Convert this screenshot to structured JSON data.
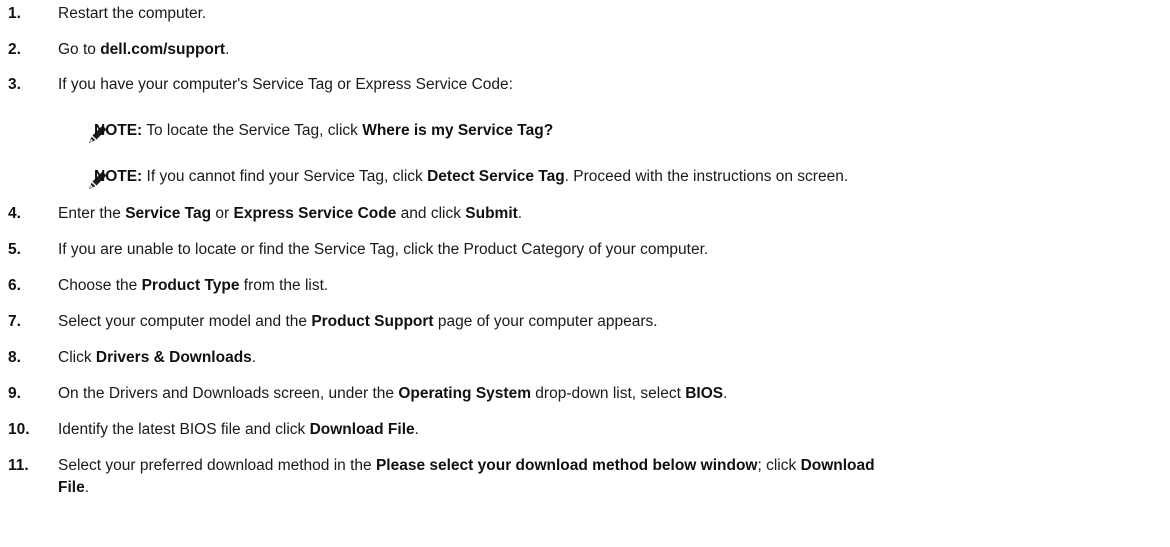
{
  "note_label": "NOTE:",
  "steps": [
    {
      "num": "1.",
      "parts": [
        "Restart the computer."
      ]
    },
    {
      "num": "2.",
      "parts": [
        "Go to ",
        "dell.com/support",
        "."
      ]
    },
    {
      "num": "3.",
      "parts": [
        "If you have your computer's Service Tag or Express Service Code:"
      ]
    },
    {
      "num": "4.",
      "parts": [
        "Enter the ",
        "Service Tag",
        " or ",
        "Express Service Code",
        " and click ",
        "Submit",
        "."
      ]
    },
    {
      "num": "5.",
      "parts": [
        "If you are unable to locate or find the Service Tag, click the Product Category of your computer."
      ]
    },
    {
      "num": "6.",
      "parts": [
        "Choose the ",
        "Product Type",
        " from the list."
      ]
    },
    {
      "num": "7.",
      "parts": [
        "Select your computer model and the ",
        "Product Support",
        " page of your computer appears."
      ]
    },
    {
      "num": "8.",
      "parts": [
        "Click ",
        "Drivers & Downloads",
        "."
      ]
    },
    {
      "num": "9.",
      "parts": [
        "On the Drivers and Downloads screen, under the ",
        "Operating System",
        " drop-down list, select ",
        "BIOS",
        "."
      ]
    },
    {
      "num": "10.",
      "parts": [
        "Identify the latest BIOS file and click ",
        "Download File",
        "."
      ]
    },
    {
      "num": "11.",
      "parts": [
        "Select your preferred download method in the ",
        "Please select your download method below window",
        "; click ",
        "Download",
        " ",
        "File",
        "."
      ]
    }
  ],
  "notes": [
    {
      "parts": [
        " To locate the Service Tag, click ",
        "Where is my Service Tag?"
      ]
    },
    {
      "parts": [
        " If you cannot find your Service Tag, click ",
        "Detect Service Tag",
        ". Proceed with the instructions on screen."
      ]
    }
  ],
  "icons": {
    "note": "pencil-note-icon"
  }
}
